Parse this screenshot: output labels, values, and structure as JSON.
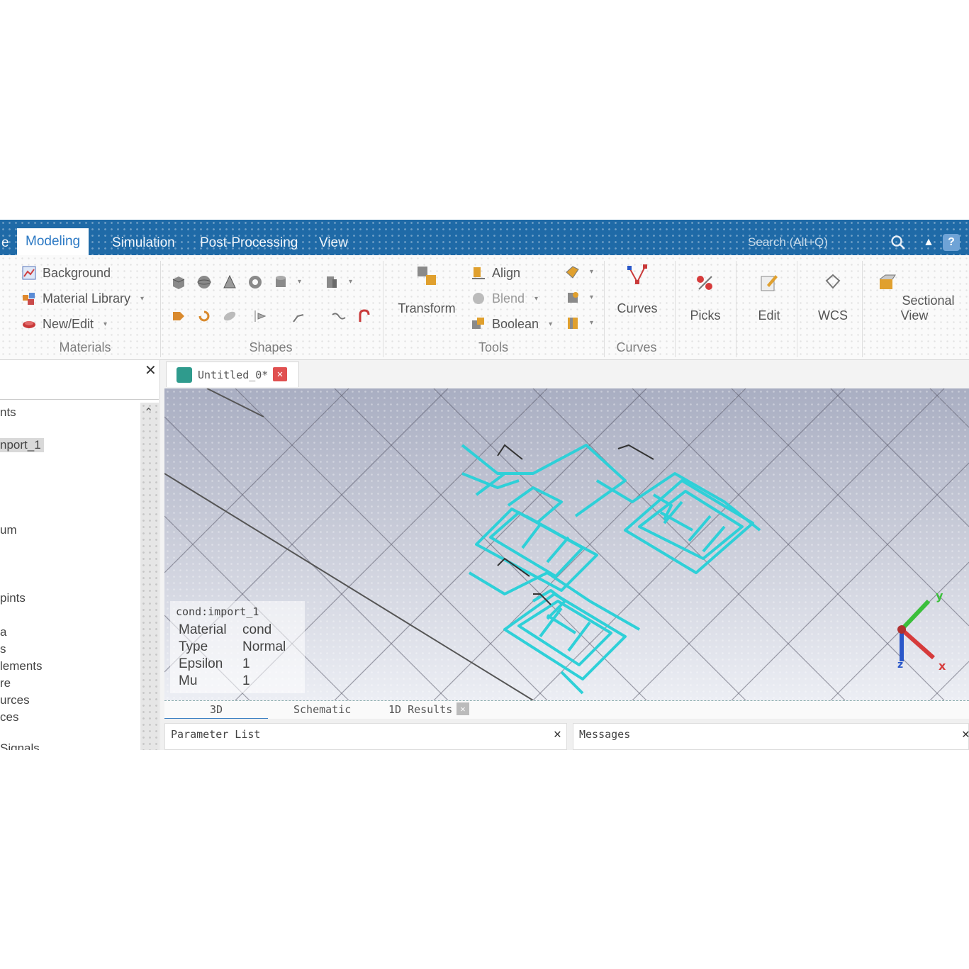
{
  "ribbon_tabs": [
    "e",
    "Modeling",
    "Simulation",
    "Post-Processing",
    "View"
  ],
  "search": {
    "placeholder": "Search (Alt+Q)"
  },
  "help": "?",
  "materials_group": {
    "label": "Materials",
    "items": [
      "Background",
      "Material Library",
      "New/Edit"
    ]
  },
  "shapes_group": {
    "label": "Shapes"
  },
  "tools_group": {
    "label": "Tools",
    "transform": "Transform",
    "items": [
      "Align",
      "Blend",
      "Boolean"
    ]
  },
  "curves_group": {
    "label": "Curves",
    "button": "Curves"
  },
  "picks": "Picks",
  "edit": "Edit",
  "wcs": "WCS",
  "sectional_view": "Sectional View",
  "tree_items": [
    "nts",
    "nport_1",
    "um",
    "pints",
    "a",
    "s",
    "lements",
    "re",
    "urces",
    "ces",
    "Signals"
  ],
  "document_tab": {
    "title": "Untitled_0*"
  },
  "info": {
    "title": "cond:import_1",
    "rows": [
      {
        "k": "Material",
        "v": "cond"
      },
      {
        "k": "Type",
        "v": "Normal"
      },
      {
        "k": "Epsilon",
        "v": "1"
      },
      {
        "k": "Mu",
        "v": "1"
      }
    ]
  },
  "axes": {
    "x": "x",
    "y": "y",
    "z": "z"
  },
  "view_tabs": [
    "3D",
    "Schematic",
    "1D Results"
  ],
  "panels": {
    "parameter_list": "Parameter List",
    "messages": "Messages"
  },
  "colors": {
    "ribbon_blue": "#1f6aa7",
    "model_cyan": "#2ecfd6",
    "axis_green": "#3bbf3b",
    "axis_red": "#d63b3b",
    "axis_blue": "#2a57c9"
  }
}
